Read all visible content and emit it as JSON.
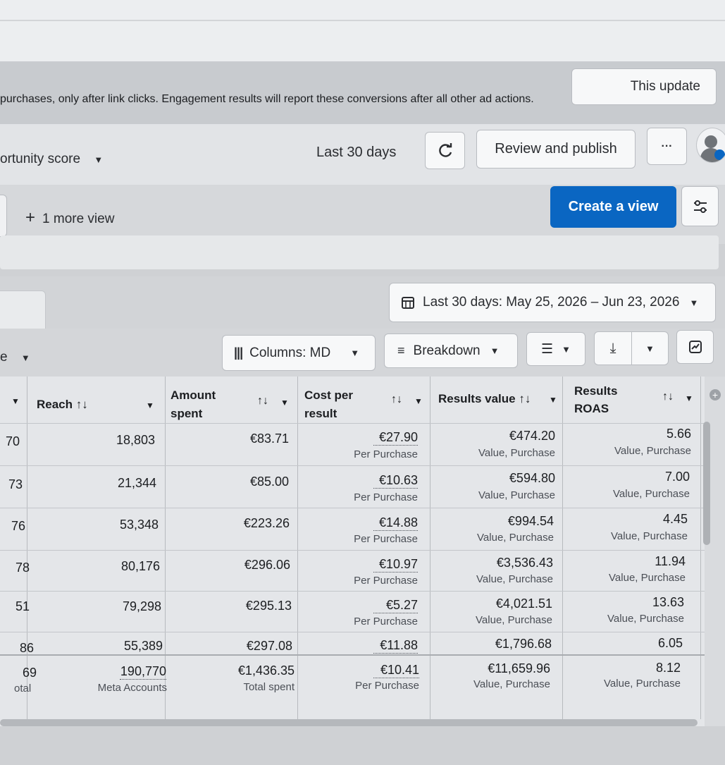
{
  "banner": {
    "text": "purchases, only after link clicks. Engagement results will report these conversions after all other ad actions.",
    "update_button": "This update"
  },
  "toolbar": {
    "opportunity_label": "ortunity score",
    "date_label": "Last 30 days",
    "review_publish": "Review and publish",
    "more_icon": "···"
  },
  "views": {
    "more_view": "1 more view",
    "create_view": "Create a view"
  },
  "date_range": {
    "label": "Last 30 days: May 25, 2026 – Jun 23, 2026"
  },
  "filters": {
    "left_label": "e",
    "columns": "Columns: MD",
    "breakdown": "Breakdown"
  },
  "table": {
    "headers": {
      "reach": "Reach ↑↓",
      "amount_spent": "Amount spent",
      "cost_per_result": "Cost per result",
      "results_value": "Results value ↑↓",
      "results_roas": "Results ROAS"
    },
    "rows": [
      {
        "id": "70",
        "reach": "18,803",
        "spent": "€83.71",
        "cpr": "€27.90",
        "cpr_sub": "Per Purchase",
        "value": "€474.20",
        "value_sub": "Value, Purchase",
        "roas": "5.66",
        "roas_sub": "Value, Purchase"
      },
      {
        "id": "73",
        "reach": "21,344",
        "spent": "€85.00",
        "cpr": "€10.63",
        "cpr_sub": "Per Purchase",
        "value": "€594.80",
        "value_sub": "Value, Purchase",
        "roas": "7.00",
        "roas_sub": "Value, Purchase"
      },
      {
        "id": "76",
        "reach": "53,348",
        "spent": "€223.26",
        "cpr": "€14.88",
        "cpr_sub": "Per Purchase",
        "value": "€994.54",
        "value_sub": "Value, Purchase",
        "roas": "4.45",
        "roas_sub": "Value, Purchase"
      },
      {
        "id": "78",
        "reach": "80,176",
        "spent": "€296.06",
        "cpr": "€10.97",
        "cpr_sub": "Per Purchase",
        "value": "€3,536.43",
        "value_sub": "Value, Purchase",
        "roas": "11.94",
        "roas_sub": "Value, Purchase"
      },
      {
        "id": "51",
        "reach": "79,298",
        "spent": "€295.13",
        "cpr": "€5.27",
        "cpr_sub": "Per Purchase",
        "value": "€4,021.51",
        "value_sub": "Value, Purchase",
        "roas": "13.63",
        "roas_sub": "Value, Purchase"
      },
      {
        "id": "86",
        "reach": "55,389",
        "spent": "€297.08",
        "cpr": "€11.88",
        "cpr_sub": "",
        "value": "€1,796.68",
        "value_sub": "",
        "roas": "6.05",
        "roas_sub": ""
      }
    ],
    "total": {
      "id": "69",
      "id_sub": "otal",
      "reach": "190,770",
      "reach_sub": "Meta Accounts",
      "spent": "€1,436.35",
      "spent_sub": "Total spent",
      "cpr": "€10.41",
      "cpr_sub": "Per Purchase",
      "value": "€11,659.96",
      "value_sub": "Value, Purchase",
      "roas": "8.12",
      "roas_sub": "Value, Purchase"
    }
  },
  "colors": {
    "primary_button": "#0a66c2",
    "background": "#d9dbde"
  }
}
